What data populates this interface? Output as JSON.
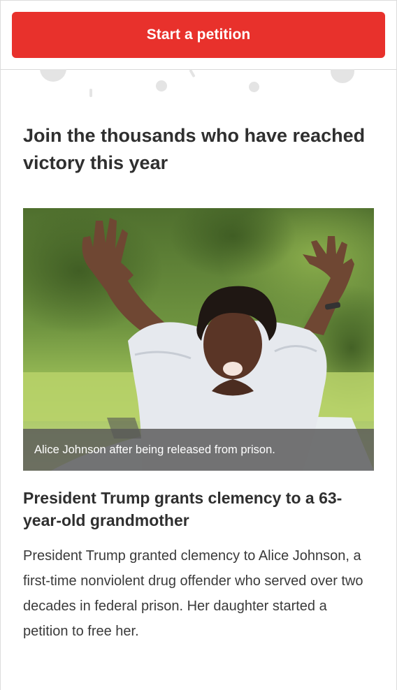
{
  "header": {
    "cta_label": "Start a petition"
  },
  "victory_section": {
    "headline": "Join the thousands who have reached victory this year"
  },
  "featured_story": {
    "image_caption": "Alice Johnson after being released from prison.",
    "title": "President Trump grants clemency to a 63-year-old grandmother",
    "description": "President Trump granted clemency to Alice Johnson, a first-time nonviolent drug offender who served over two decades in federal prison. Her daughter started a petition to free her."
  },
  "colors": {
    "accent": "#e8312c",
    "text": "#2f2f2f",
    "caption_overlay": "#585858",
    "divider": "#dadada"
  }
}
